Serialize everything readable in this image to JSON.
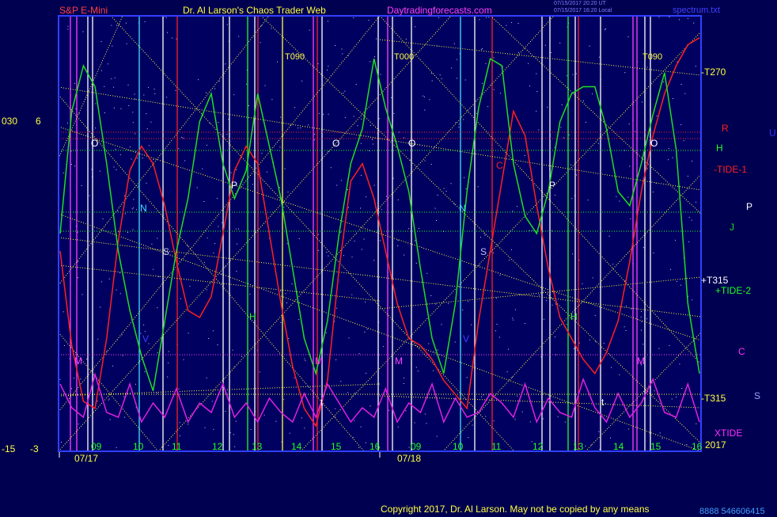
{
  "header": {
    "symbol": "S&P E-Mini",
    "title": "Dr. Al Larson's Chaos Trader Web",
    "site": "Daytradingforecasts.com",
    "stamp1": "07/15/2017 20:20 UT",
    "stamp2": "07/15/2017 16:20 Local",
    "file": "spectrum.txt"
  },
  "left_scale": {
    "a": "030",
    "b": "6",
    "c": "-15",
    "d": "-3"
  },
  "right_labels": {
    "t270": "-T270",
    "r": "R",
    "u": "U",
    "h": "H",
    "tide1": "-TIDE-1",
    "p": "P",
    "j": "J",
    "t315p": "+T315",
    "tide2": "+TIDE-2",
    "c": "C",
    "t315m": "-T315",
    "s": "S",
    "xtide": "XTIDE",
    "year": "2017"
  },
  "copyright": "Copyright 2017, Dr. Al Larson. May not be copied by any means",
  "footer_code": "8888 546606415",
  "chart_data": {
    "type": "line",
    "x_labels": [
      "09",
      "10",
      "11",
      "12",
      "13",
      "14",
      "15",
      "16",
      "09",
      "10",
      "11",
      "12",
      "13",
      "14",
      "15",
      "16"
    ],
    "day_labels": [
      "07/17",
      "07/18"
    ],
    "top_marks": [
      "T090",
      "T000",
      "T090"
    ],
    "series": [
      {
        "name": "R",
        "color": "#ff2020",
        "values": [
          55,
          28,
          12,
          10,
          30,
          58,
          78,
          85,
          80,
          68,
          52,
          38,
          36,
          42,
          60,
          78,
          85,
          80,
          60,
          40,
          22,
          10,
          5,
          18,
          50,
          75,
          80,
          70,
          55,
          40,
          30,
          28,
          24,
          18,
          14,
          10,
          35,
          55,
          75,
          95,
          88,
          68,
          50,
          36,
          30,
          24,
          20,
          26,
          35,
          52,
          72,
          88,
          100,
          108,
          114,
          116
        ]
      },
      {
        "name": "H",
        "color": "#20dd20",
        "values": [
          60,
          95,
          108,
          102,
          80,
          55,
          38,
          25,
          15,
          35,
          55,
          70,
          92,
          100,
          80,
          70,
          78,
          100,
          85,
          70,
          50,
          30,
          20,
          35,
          60,
          80,
          90,
          110,
          96,
          85,
          72,
          50,
          30,
          20,
          40,
          72,
          96,
          110,
          108,
          80,
          65,
          60,
          72,
          92,
          100,
          102,
          102,
          90,
          72,
          68,
          80,
          94,
          106,
          84,
          40,
          20
        ]
      },
      {
        "name": "XTIDE",
        "color": "#e020e0",
        "values": [
          10,
          5,
          3,
          12,
          4,
          3,
          10,
          2,
          6,
          3,
          9,
          2,
          6,
          4,
          10,
          3,
          6,
          2,
          7,
          4,
          2,
          8,
          3,
          10,
          6,
          2,
          5,
          3,
          9,
          2,
          6,
          4,
          10,
          2,
          7,
          3,
          4,
          8,
          6,
          3,
          10,
          2,
          7,
          4,
          3,
          11,
          5,
          2,
          8,
          3,
          6,
          11,
          4,
          3,
          10,
          2
        ]
      }
    ],
    "ylim": [
      0,
      120
    ],
    "grid": false
  }
}
